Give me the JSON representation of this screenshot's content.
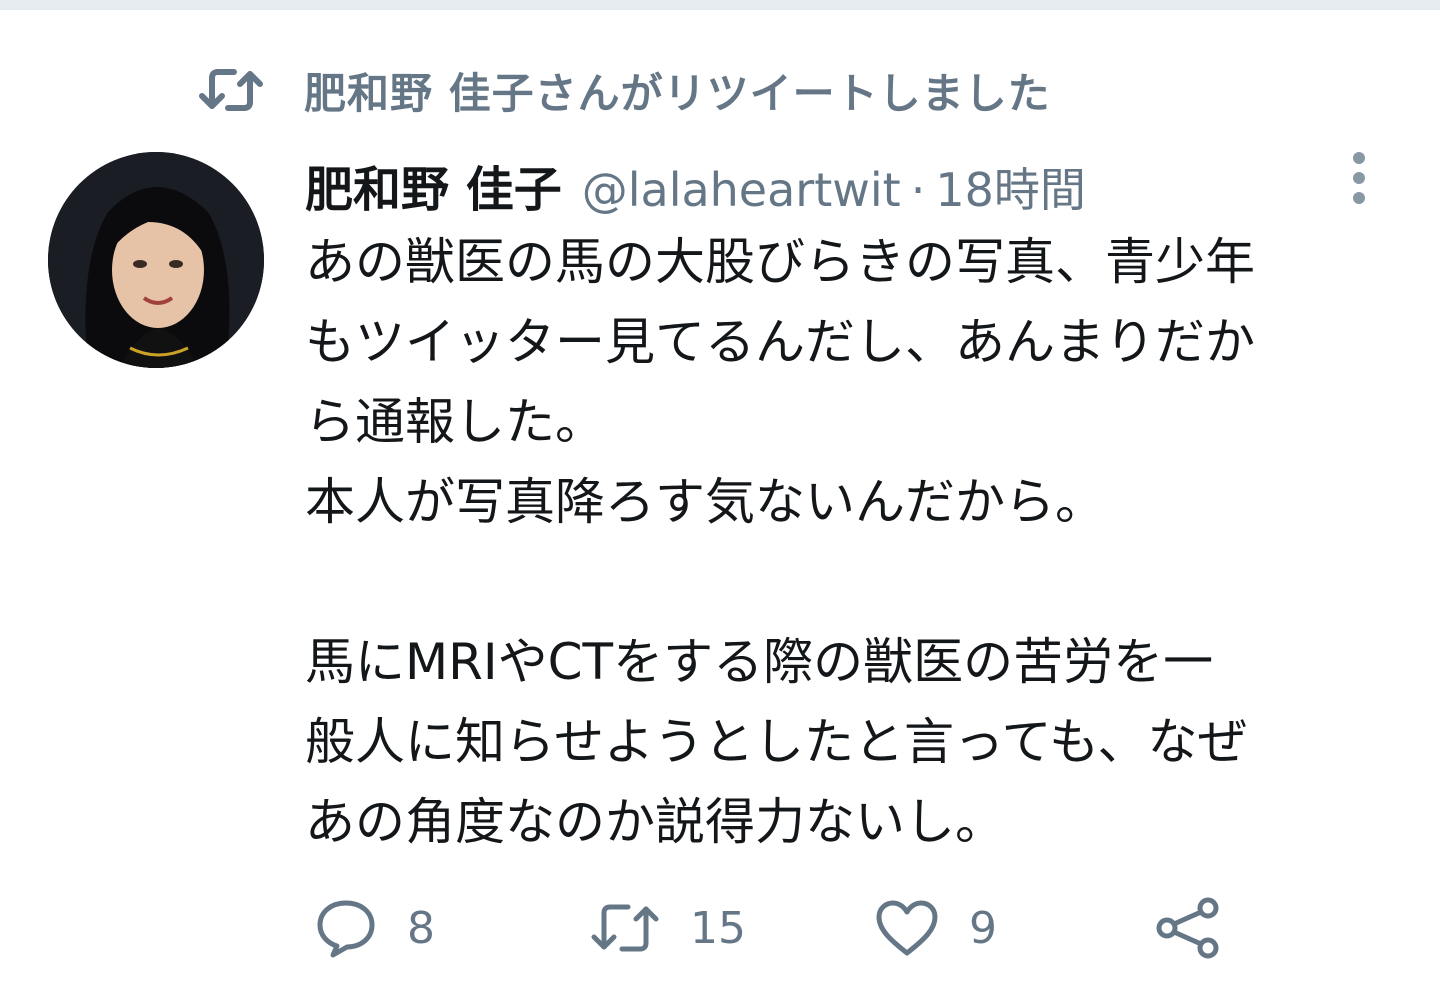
{
  "retweet_banner": {
    "text": "肥和野 佳子さんがリツイートしました",
    "icon": "retweet-icon"
  },
  "tweet": {
    "author_name": "肥和野 佳子",
    "handle": "@lalaheartwit",
    "separator": "·",
    "time": "18時間",
    "body": "あの獣医の馬の大股びらきの写真、青少年\nもツイッター見てるんだし、あんまりだか\nら通報した。\n本人が写真降ろす気ないんだから。\n\n馬にMRIやCTをする際の獣医の苦労を一\n般人に知らせようとしたと言っても、なぜ\nあの角度なのか説得力ないし。"
  },
  "actions": {
    "reply_count": "8",
    "retweet_count": "15",
    "like_count": "9"
  },
  "colors": {
    "text_primary": "#14171a",
    "text_secondary": "#657786",
    "icon": "#657786"
  }
}
